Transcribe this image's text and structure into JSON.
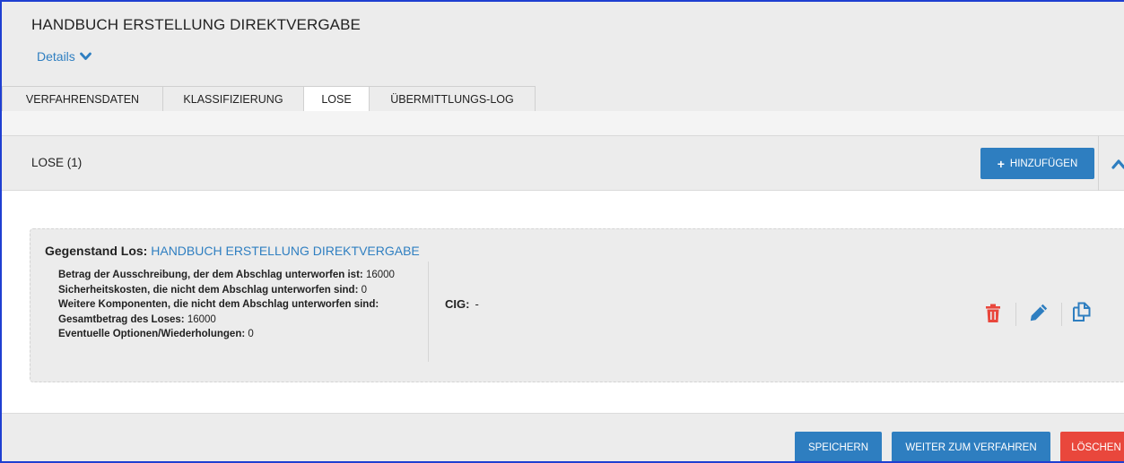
{
  "header": {
    "title": "HANDBUCH ERSTELLUNG DIREKTVERGABE",
    "details_label": "Details"
  },
  "tabs": [
    {
      "label": "VERFAHRENSDATEN",
      "active": false
    },
    {
      "label": "KLASSIFIZIERUNG",
      "active": false
    },
    {
      "label": "LOSE",
      "active": true
    },
    {
      "label": "ÜBERMITTLUNGS-LOG",
      "active": false
    }
  ],
  "section": {
    "title": "LOSE (1)",
    "add_button": "HINZUFÜGEN"
  },
  "lot": {
    "subject_label": "Gegenstand Los:",
    "subject_value": "HANDBUCH ERSTELLUNG DIREKTVERGABE",
    "lines": [
      {
        "label": "Betrag der Ausschreibung, der dem Abschlag unterworfen ist:",
        "value": "16000"
      },
      {
        "label": "Sicherheitskosten, die nicht dem Abschlag unterworfen sind:",
        "value": "0"
      },
      {
        "label": "Weitere Komponenten, die nicht dem Abschlag unterworfen sind:",
        "value": ""
      },
      {
        "label": "Gesamtbetrag des Loses:",
        "value": "16000"
      },
      {
        "label": "Eventuelle Optionen/Wiederholungen:",
        "value": "0"
      }
    ],
    "cig_label": "CIG:",
    "cig_value": "-",
    "icons": [
      "trash-icon",
      "pencil-icon",
      "copy-icon"
    ]
  },
  "footer": {
    "save": "SPEICHERN",
    "next": "WEITER ZUM VERFAHREN",
    "delete": "LÖSCHEN"
  },
  "colors": {
    "accent": "#2e7ec0",
    "link": "#2f7fc1",
    "danger": "#e9473c",
    "panel": "#ececec"
  }
}
